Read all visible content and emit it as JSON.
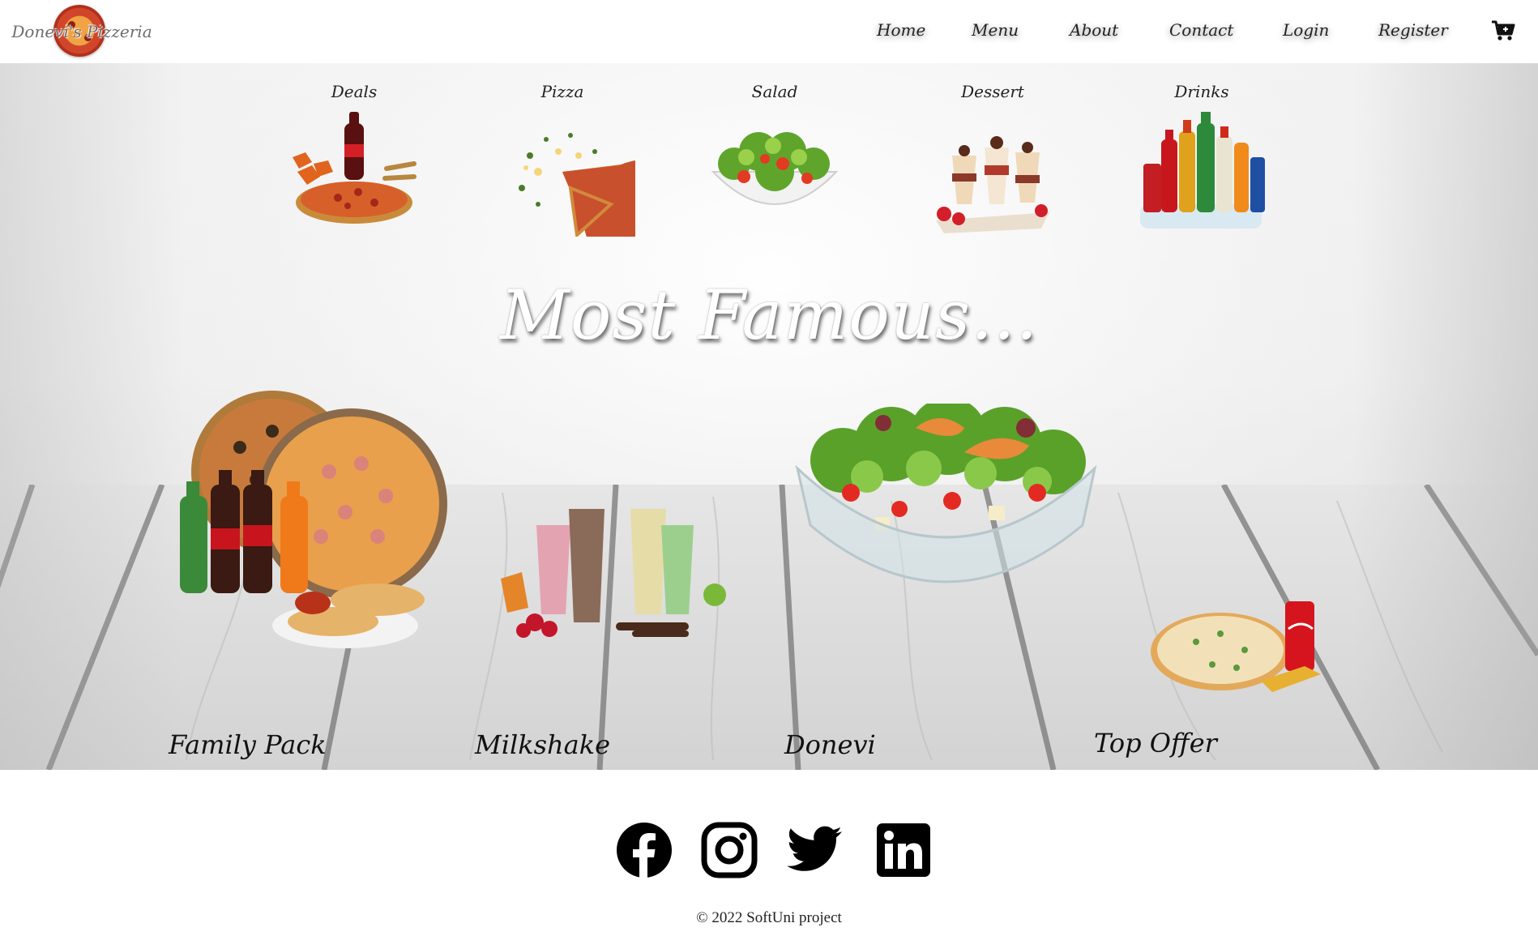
{
  "header": {
    "logo_text": "Donevi's Pizzeria",
    "nav": [
      "Home",
      "Menu",
      "About",
      "Contact",
      "Login",
      "Register"
    ],
    "cart_icon": "shopping-cart-icon"
  },
  "categories": [
    {
      "label": "Deals",
      "image": "deals-image"
    },
    {
      "label": "Pizza",
      "image": "pizza-image"
    },
    {
      "label": "Salad",
      "image": "salad-image"
    },
    {
      "label": "Dessert",
      "image": "dessert-image"
    },
    {
      "label": "Drinks",
      "image": "drinks-image"
    }
  ],
  "famous": {
    "title": "Most Famous...",
    "products": [
      {
        "label": "Family Pack",
        "image": "family-pack-image"
      },
      {
        "label": "Milkshake",
        "image": "milkshake-image"
      },
      {
        "label": "Donevi",
        "image": "donevi-salad-image"
      },
      {
        "label": "Top Offer",
        "image": "top-offer-image"
      }
    ]
  },
  "footer": {
    "social": [
      "facebook-icon",
      "instagram-icon",
      "twitter-icon",
      "linkedin-icon"
    ],
    "copyright": "© 2022 SoftUni project"
  },
  "colors": {
    "text": "#222222",
    "background": "#ffffff",
    "brand_red": "#d1452a"
  }
}
